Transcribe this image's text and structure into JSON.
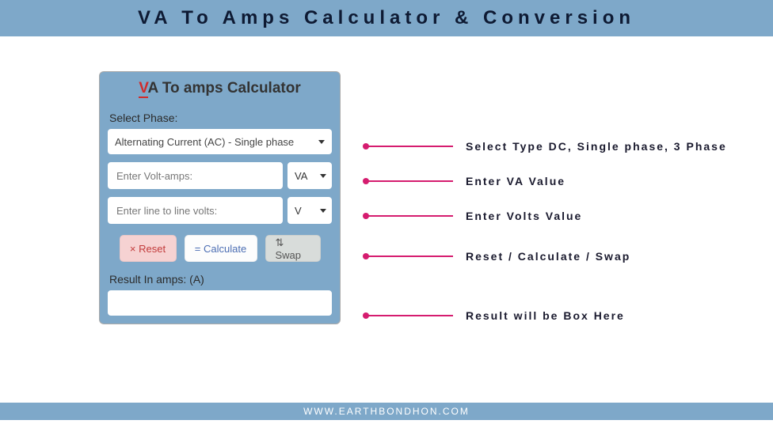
{
  "header": {
    "title": "VA To Amps Calculator & Conversion"
  },
  "calc": {
    "title_prefix": "V",
    "title_rest": "A To amps Calculator",
    "phase_label": "Select Phase:",
    "phase_value": "Alternating Current (AC) - Single phase",
    "va_placeholder": "Enter Volt-amps:",
    "va_unit": "VA",
    "volts_placeholder": "Enter line to line volts:",
    "volts_unit": "V",
    "reset_label": "× Reset",
    "calc_label": "= Calculate",
    "swap_label": "⇅ Swap",
    "result_label": "Result In amps: (A)"
  },
  "annotations": {
    "a1": "Select Type DC, Single phase, 3 Phase",
    "a2": "Enter VA Value",
    "a3": "Enter Volts Value",
    "a4": "Reset / Calculate / Swap",
    "a5": "Result will be Box Here"
  },
  "footer": {
    "text": "WWW.EARTHBONDHON.COM"
  }
}
